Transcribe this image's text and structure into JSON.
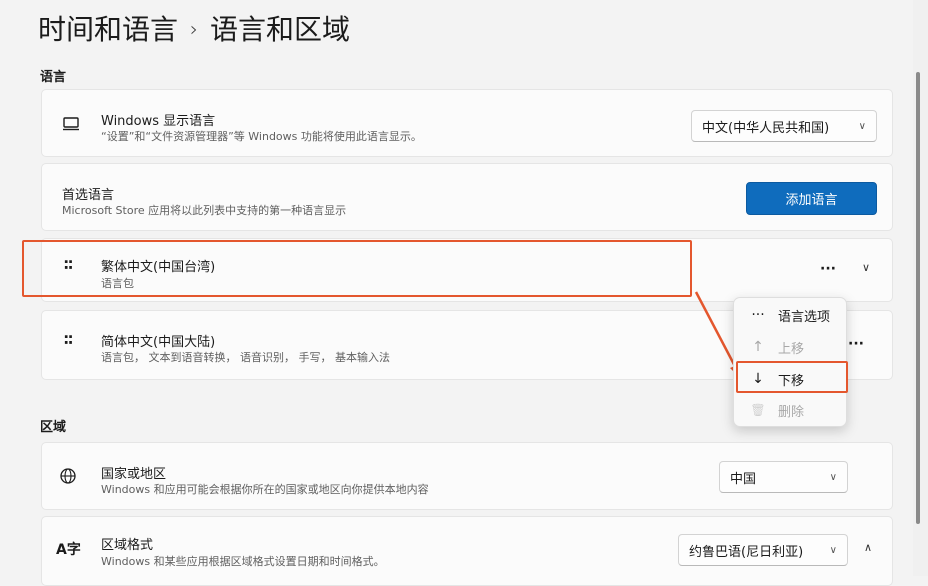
{
  "breadcrumb": {
    "parent": "时间和语言",
    "separator": "›",
    "current": "语言和区域"
  },
  "sections": {
    "language": "语言",
    "region": "区域"
  },
  "display_language": {
    "title": "Windows 显示语言",
    "subtitle": "“设置”和“文件资源管理器”等 Windows 功能将使用此语言显示。",
    "value": "中文(中华人民共和国)"
  },
  "preferred": {
    "title": "首选语言",
    "subtitle": "Microsoft Store 应用将以此列表中支持的第一种语言显示",
    "add_button": "添加语言"
  },
  "languages": [
    {
      "title": "繁体中文(中国台湾)",
      "subtitle": "语言包"
    },
    {
      "title": "简体中文(中国大陆)",
      "subtitle": "语言包， 文本到语音转换， 语音识别， 手写， 基本输入法"
    }
  ],
  "context_menu": {
    "items": [
      {
        "icon": "···",
        "label": "语言选项",
        "enabled": true
      },
      {
        "icon": "↑",
        "label": "上移",
        "enabled": false
      },
      {
        "icon": "↓",
        "label": "下移",
        "enabled": true
      },
      {
        "icon": "🗑",
        "label": "删除",
        "enabled": false
      }
    ]
  },
  "country": {
    "title": "国家或地区",
    "subtitle": "Windows 和应用可能会根据你所在的国家或地区向你提供本地内容",
    "value": "中国"
  },
  "regional_format": {
    "title": "区域格式",
    "subtitle": "Windows 和某些应用根据区域格式设置日期和时间格式。",
    "value": "约鲁巴语(尼日利亚)"
  },
  "more_label": "···",
  "colors": {
    "accent": "#0f6cbd",
    "highlight": "#e4572e"
  }
}
